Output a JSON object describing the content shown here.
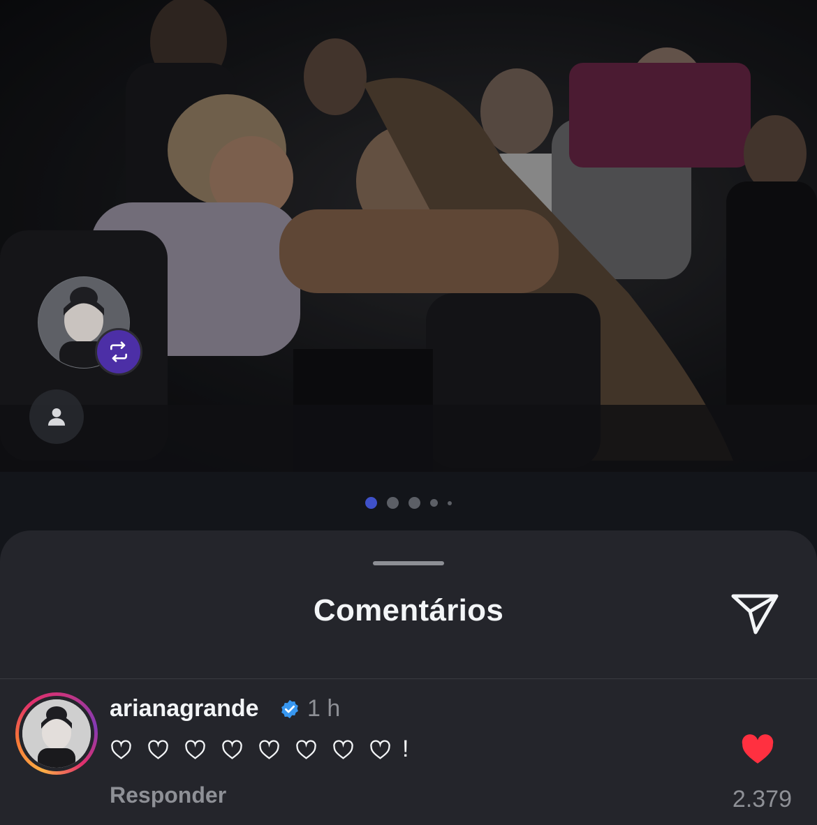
{
  "post": {
    "carousel": {
      "total": 5,
      "active_index": 0
    }
  },
  "comments_sheet": {
    "title": "Comentários",
    "comments": [
      {
        "username": "arianagrande",
        "verified": true,
        "time": "1 h",
        "text_hearts": 8,
        "text_suffix": "!",
        "reply_label": "Responder",
        "liked": true,
        "like_count": "2.379"
      }
    ]
  },
  "icons": {
    "repost": "repost-icon",
    "user_tag": "user-tag-icon",
    "send": "send-icon",
    "verified": "verified-badge-icon",
    "heart_outline": "heart-outline-icon",
    "heart_filled": "heart-filled-icon"
  },
  "colors": {
    "like_red": "#ff3040",
    "carousel_active": "#3f51c9",
    "repost_badge": "#4c2fa6",
    "verified_blue": "#3897f0"
  }
}
